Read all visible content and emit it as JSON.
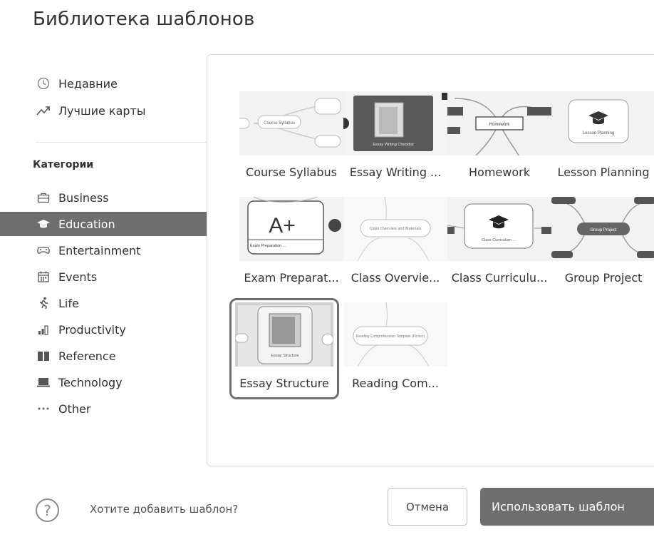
{
  "dialog": {
    "title": "Библиотека шаблонов"
  },
  "sidebar": {
    "top_items": [
      {
        "label": "Недавние",
        "icon": "clock-icon"
      },
      {
        "label": "Лучшие карты",
        "icon": "trending-icon"
      }
    ],
    "categories_title": "Категории",
    "categories": [
      {
        "label": "Business",
        "icon": "briefcase-icon"
      },
      {
        "label": "Education",
        "icon": "graduation-cap-icon",
        "active": true
      },
      {
        "label": "Entertainment",
        "icon": "gamepad-icon"
      },
      {
        "label": "Events",
        "icon": "calendar-icon"
      },
      {
        "label": "Life",
        "icon": "running-person-icon"
      },
      {
        "label": "Productivity",
        "icon": "bar-chart-icon"
      },
      {
        "label": "Reference",
        "icon": "book-icon"
      },
      {
        "label": "Technology",
        "icon": "laptop-icon"
      },
      {
        "label": "Other",
        "icon": "dots-icon"
      }
    ]
  },
  "templates": [
    {
      "label": "Course Syllabus",
      "thumb_text": "Course Syllabus"
    },
    {
      "label": "Essay Writing ...",
      "thumb_text": "Essay Writing Checklist"
    },
    {
      "label": "Homework",
      "thumb_text": "Homework"
    },
    {
      "label": "Lesson Planning",
      "thumb_text": "Lesson Planning"
    },
    {
      "label": "Exam Preparat...",
      "thumb_text": "Exam Preparation ...",
      "big_text": "A+"
    },
    {
      "label": "Class Overvie...",
      "thumb_text": "Class Overview and Materials"
    },
    {
      "label": "Class Curriculu...",
      "thumb_text": "Class Curriculum ..."
    },
    {
      "label": "Group Project",
      "thumb_text": "Group Project"
    },
    {
      "label": "Essay Structure",
      "thumb_text": "Essay Structure",
      "selected": true
    },
    {
      "label": "Reading Com...",
      "thumb_text": "Reading Comprehension Template (Fiction)"
    }
  ],
  "footer": {
    "help_text": "Хотите добавить шаблон?",
    "cancel_label": "Отмена",
    "use_label": "Использовать шаблон"
  },
  "colors": {
    "accent": "#6e6e6e",
    "border": "#d9d9d9",
    "thumb_bg": "#f2f2f2"
  }
}
